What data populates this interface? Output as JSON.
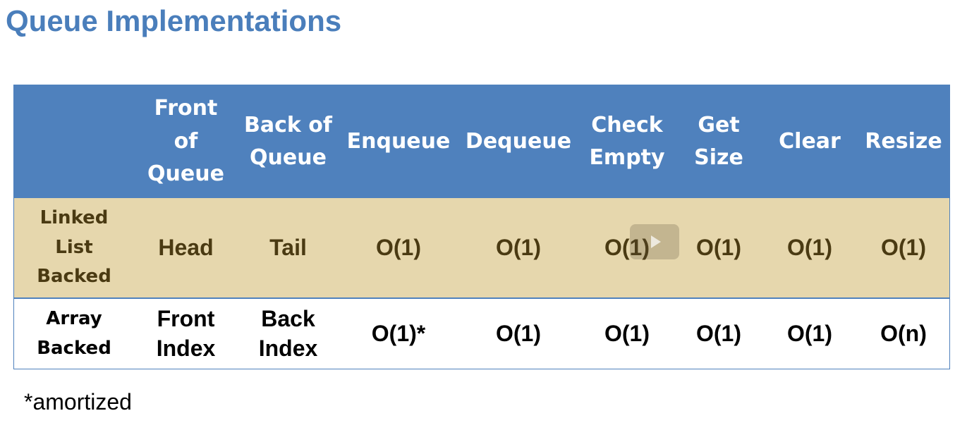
{
  "title": "Queue Implementations",
  "table": {
    "headers": [
      "",
      "Front of Queue",
      "Back of Queue",
      "Enqueue",
      "Dequeue",
      "Check Empty",
      "Get Size",
      "Clear",
      "Resize"
    ],
    "rows": [
      {
        "label": "Linked List Backed",
        "cells": [
          "Head",
          "Tail",
          "O(1)",
          "O(1)",
          "O(1)",
          "O(1)",
          "O(1)",
          "O(1)"
        ]
      },
      {
        "label": "Array Backed",
        "cells": [
          "Front Index",
          "Back Index",
          "O(1)*",
          "O(1)",
          "O(1)",
          "O(1)",
          "O(1)",
          "O(n)"
        ]
      }
    ]
  },
  "footnote": "*amortized",
  "colors": {
    "title": "#4a7ebb",
    "header_bg": "#4f81bd",
    "linked_row_bg": "#e6d7ad",
    "linked_row_text": "#4a3a12"
  },
  "overlay_icon": "play-icon"
}
